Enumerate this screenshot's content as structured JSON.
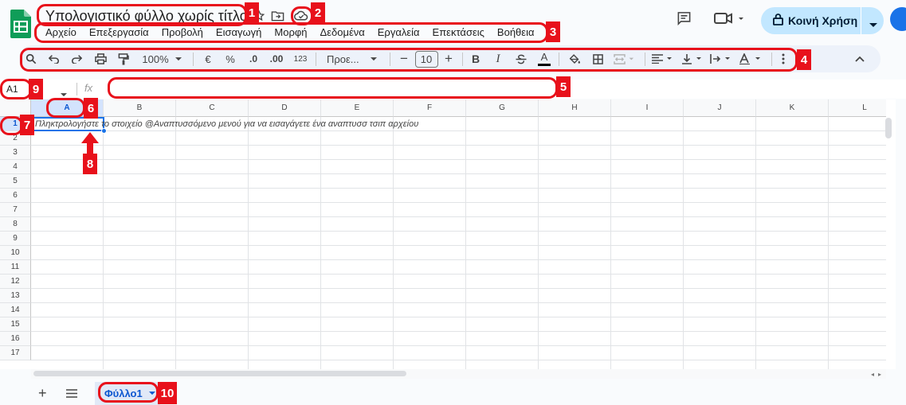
{
  "app": {
    "title": "Υπολογιστικό φύλλο χωρίς τίτλο",
    "accent": "#1a73e8",
    "annotation_color": "#e8111b"
  },
  "menu": [
    "Αρχείο",
    "Επεξεργασία",
    "Προβολή",
    "Εισαγωγή",
    "Μορφή",
    "Δεδομένα",
    "Εργαλεία",
    "Επεκτάσεις",
    "Βοήθεια"
  ],
  "header_icons": [
    "star-icon",
    "move-folder-icon",
    "cloud-saved-icon",
    "comments-icon",
    "meet-video-icon"
  ],
  "share": {
    "label": "Κοινή Χρήση"
  },
  "toolbar": {
    "zoom": "100%",
    "currency": "€",
    "percent": "%",
    "decrease_decimal": ".0",
    "increase_decimal": ".00",
    "number_format": "123",
    "font": "Προε...",
    "font_size": "10",
    "bold": "B",
    "italic": "I"
  },
  "formula_bar": {
    "name_box": "A1",
    "fx": "fx",
    "value": ""
  },
  "grid": {
    "columns": [
      "A",
      "B",
      "C",
      "D",
      "E",
      "F",
      "G",
      "H",
      "I",
      "J",
      "K",
      "L"
    ],
    "rows": [
      "1",
      "2",
      "3",
      "4",
      "5",
      "6",
      "7",
      "8",
      "9",
      "10",
      "11",
      "12",
      "13",
      "14",
      "15",
      "16",
      "17"
    ],
    "active_cell": "A1",
    "a1_placeholder": "Πληκτρολογήστε το στοιχείο @Αναπτυσσόμενο μενού για να εισαγάγετε ένα αναπτυσσ τσιπ αρχείου"
  },
  "sheets": [
    {
      "name": "Φύλλο1"
    }
  ],
  "annotations": [
    "1",
    "2",
    "3",
    "4",
    "5",
    "6",
    "7",
    "8",
    "9",
    "10"
  ]
}
